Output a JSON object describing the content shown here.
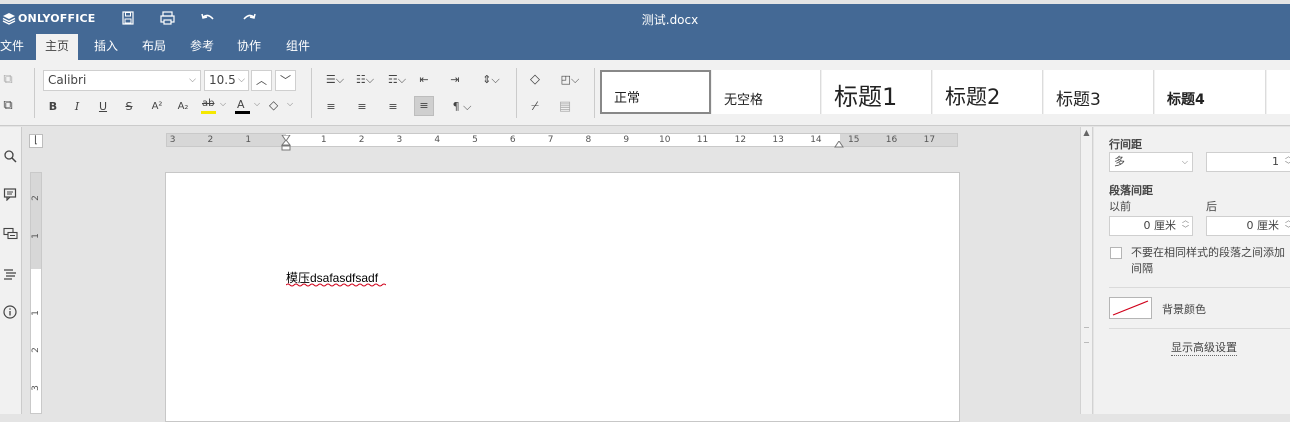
{
  "app": {
    "brand": "ONLYOFFICE",
    "doc_title": "测试.docx"
  },
  "header_icons": [
    "save-icon",
    "print-icon",
    "undo-icon",
    "redo-icon"
  ],
  "tabs": [
    {
      "label": "文件"
    },
    {
      "label": "主页"
    },
    {
      "label": "插入"
    },
    {
      "label": "布局"
    },
    {
      "label": "参考"
    },
    {
      "label": "协作"
    },
    {
      "label": "组件"
    }
  ],
  "toolbar": {
    "font_name": "Calibri",
    "font_size": "10.5",
    "format_glyphs": {
      "bold": "B",
      "italic": "I",
      "underline": "U",
      "strike": "S",
      "superscript": "A²",
      "subscript": "A₂",
      "highlight": "ab",
      "font_color": "A"
    }
  },
  "styles": [
    {
      "label": "正常"
    },
    {
      "label": "无空格"
    },
    {
      "label": "标题1"
    },
    {
      "label": "标题2"
    },
    {
      "label": "标题3"
    },
    {
      "label": "标题4"
    }
  ],
  "ruler": {
    "h_left": [
      "3",
      "2",
      "1"
    ],
    "h_right": [
      "1",
      "2",
      "3",
      "4",
      "5",
      "6",
      "7",
      "8",
      "9",
      "10",
      "11",
      "12",
      "13",
      "14",
      "15",
      "16",
      "17"
    ],
    "v_labels": [
      "2",
      "1",
      "1",
      "2",
      "3"
    ]
  },
  "document": {
    "text": "模压dsafasdfsadf"
  },
  "panel": {
    "line_spacing_label": "行间距",
    "line_spacing_mode": "多",
    "line_spacing_value": "1",
    "para_spacing_label": "段落间距",
    "before_label": "以前",
    "after_label": "后",
    "before_value": "0 厘米",
    "after_value": "0 厘米",
    "no_space_label": "不要在相同样式的段落之间添加间隔",
    "no_space_checked": false,
    "bg_color_label": "背景颜色",
    "advanced_link": "显示高级设置"
  },
  "colors": {
    "header": "#446995",
    "toolbar": "#f1f1f1",
    "canvas": "#e4e4e4",
    "spell_underline": "#d0021b"
  }
}
